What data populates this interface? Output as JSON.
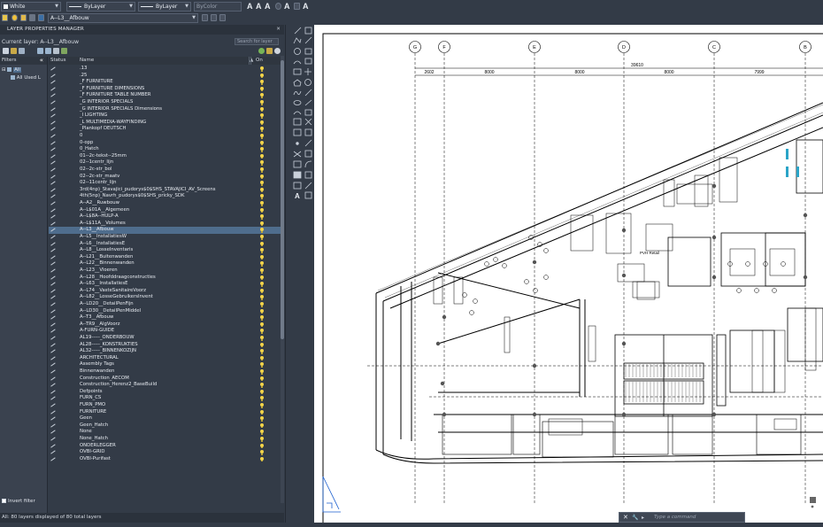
{
  "ribbon": {
    "color_value": "White",
    "linetype_value": "ByLayer",
    "lineweight_value": "ByLayer",
    "plotstyle_value": "ByColor",
    "layer_dropdown_value": "A--L3__Afbouw"
  },
  "palette": {
    "title": "LAYER PROPERTIES MANAGER",
    "close_glyph": "✕",
    "current_layer_label": "Current layer: A--L3__Afbouw",
    "search_placeholder": "Search for layer",
    "filters_header": "Filters",
    "collapse_glyph": "«",
    "tree_all": "All",
    "tree_all_used": "All Used L",
    "invert_filter_label": "Invert filter",
    "columns": {
      "status": "Status",
      "name": "Name",
      "on": "On"
    },
    "status_bar": "All: 80 layers displayed of 80 total layers",
    "selected_layer": "A--L3__Afbouw",
    "layers": [
      ".13",
      ".25",
      "_F FURNITURE",
      "_F FURNITURE DIMENSIONS",
      "_F FURNITURE TABLE NUMBER",
      "_G INTERIOR SPECIALS",
      "_G INTERIOR SPECIALS Dimensions",
      "_I LIGHTING",
      "_L MULTIMEDIA-WAYFINDING",
      "_Plankopf DEUTSCH",
      "0",
      "0-opp",
      "0_Hatch",
      "01--2c-tekst--25mm",
      "02--1centr_lijn",
      "02--2c-str_bol",
      "02--2c-str_maatv",
      "02--11centr_lijn",
      "3rd(4np)_Stavajici_pudorys$0$SHS_STAVAJICI_AV_Screens",
      "4th(5np)_Navrh_pudorys$0$SHS_pricky_SDK",
      "A--A2__Ruwbouw",
      "A--L$01A__Algemeen",
      "A--L$8A--HULP-A",
      "A--L$11A__Volumes",
      "A--L3__Afbouw",
      "A--L5__InstallatiesW",
      "A--L6__InstallatiesE",
      "A--L8__LosseInventaris",
      "A--L21__Buitenwanden",
      "A--L22__Binnenwanden",
      "A--L23__Vloeren",
      "A--L28__Hoofddraagconstructies",
      "A--L63__InstallatiesE",
      "A--L74__VasteSanitaireVoorz",
      "A--L82__LosseGebruikersInvent",
      "A--LD20__DetailPenFijn",
      "A--LD30__DetailPenMiddel",
      "A--T3__Afbouw",
      "A--TR9__AlgVoorz",
      "A-FURN-GUIDE",
      "AL19-----_ONDERBOUW",
      "AL28-----_KONSTRUKTIES",
      "AL32-----_BINNENKOZIJN",
      "ARCHITECTURAL",
      "Assembly Tags",
      "Binnenwanden",
      "Construction_AECOM",
      "Construction_Herenz2_BaseBuild",
      "Defpoints",
      "FURN_CS",
      "FURN_PMO",
      "FURNITURE",
      "Geen",
      "Geen_Hatch",
      "None",
      "None_Hatch",
      "ONDERLEGGER",
      "OVBI-GRID",
      "OVBI-Purifast"
    ]
  },
  "drawing": {
    "grid_labels": [
      "G",
      "F",
      "E",
      "D",
      "C",
      "B"
    ],
    "dimensions": [
      "2602",
      "8000",
      "8000",
      "8000",
      "7999"
    ],
    "overall_dimension": "39610",
    "room_label": "PVH Retail"
  },
  "command_line": {
    "close_glyph": "✕",
    "wrench_glyph": "🔧",
    "prompt_glyph": "▸",
    "placeholder": "Type a command"
  },
  "colors": {
    "ui_background": "#333b47",
    "selection": "#4f6d8d",
    "bulb_on": "#f5d54a",
    "canvas": "#ffffff"
  }
}
